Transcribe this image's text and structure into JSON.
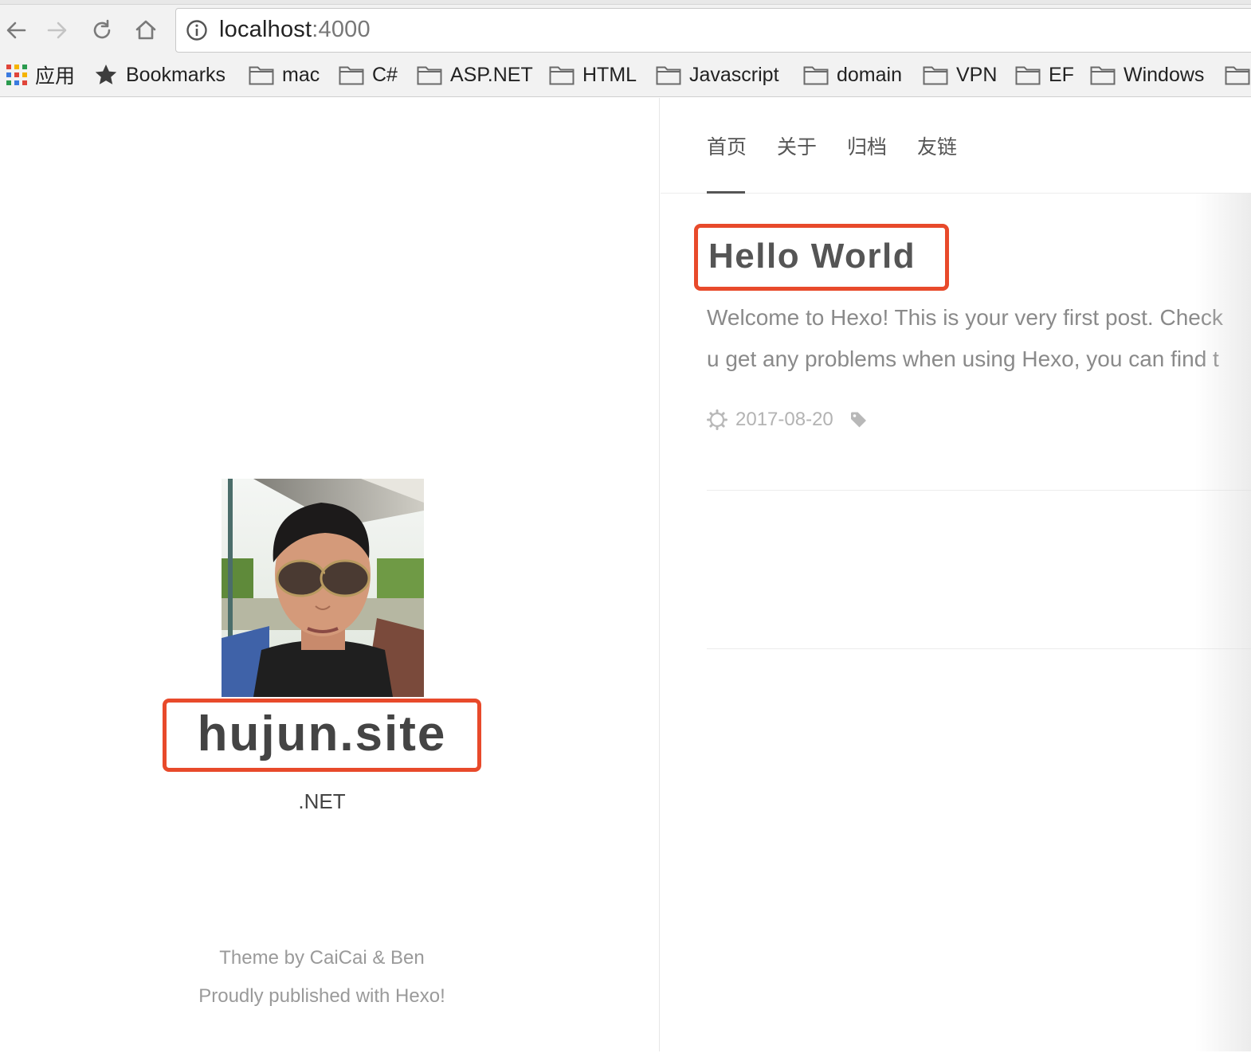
{
  "browser": {
    "url_host": "localhost",
    "url_port": ":4000",
    "bookmarks": [
      {
        "label": "应用",
        "icon": "apps-grid-icon"
      },
      {
        "label": "Bookmarks",
        "icon": "star-icon"
      },
      {
        "label": "mac",
        "icon": "folder-icon"
      },
      {
        "label": "C#",
        "icon": "folder-icon"
      },
      {
        "label": "ASP.NET",
        "icon": "folder-icon"
      },
      {
        "label": "HTML",
        "icon": "folder-icon"
      },
      {
        "label": "Javascript",
        "icon": "folder-icon"
      },
      {
        "label": "domain",
        "icon": "folder-icon"
      },
      {
        "label": "VPN",
        "icon": "folder-icon"
      },
      {
        "label": "EF",
        "icon": "folder-icon"
      },
      {
        "label": "Windows",
        "icon": "folder-icon"
      }
    ]
  },
  "sidebar": {
    "site_title": "hujun.site",
    "subtitle": ".NET",
    "footer_theme": "Theme by CaiCai & Ben",
    "footer_published": "Proudly published with Hexo!"
  },
  "nav": {
    "items": [
      "首页",
      "关于",
      "归档",
      "友链"
    ],
    "active_index": 0
  },
  "post": {
    "title": "Hello World",
    "excerpt_line1": "Welcome to Hexo! This is your very first post. Check",
    "excerpt_line2": "u get any problems when using Hexo, you can find t",
    "date": "2017-08-20"
  },
  "colors": {
    "highlight_box": "#e84a2b",
    "text_dark": "#444444",
    "text_muted": "#8a8a8a"
  }
}
